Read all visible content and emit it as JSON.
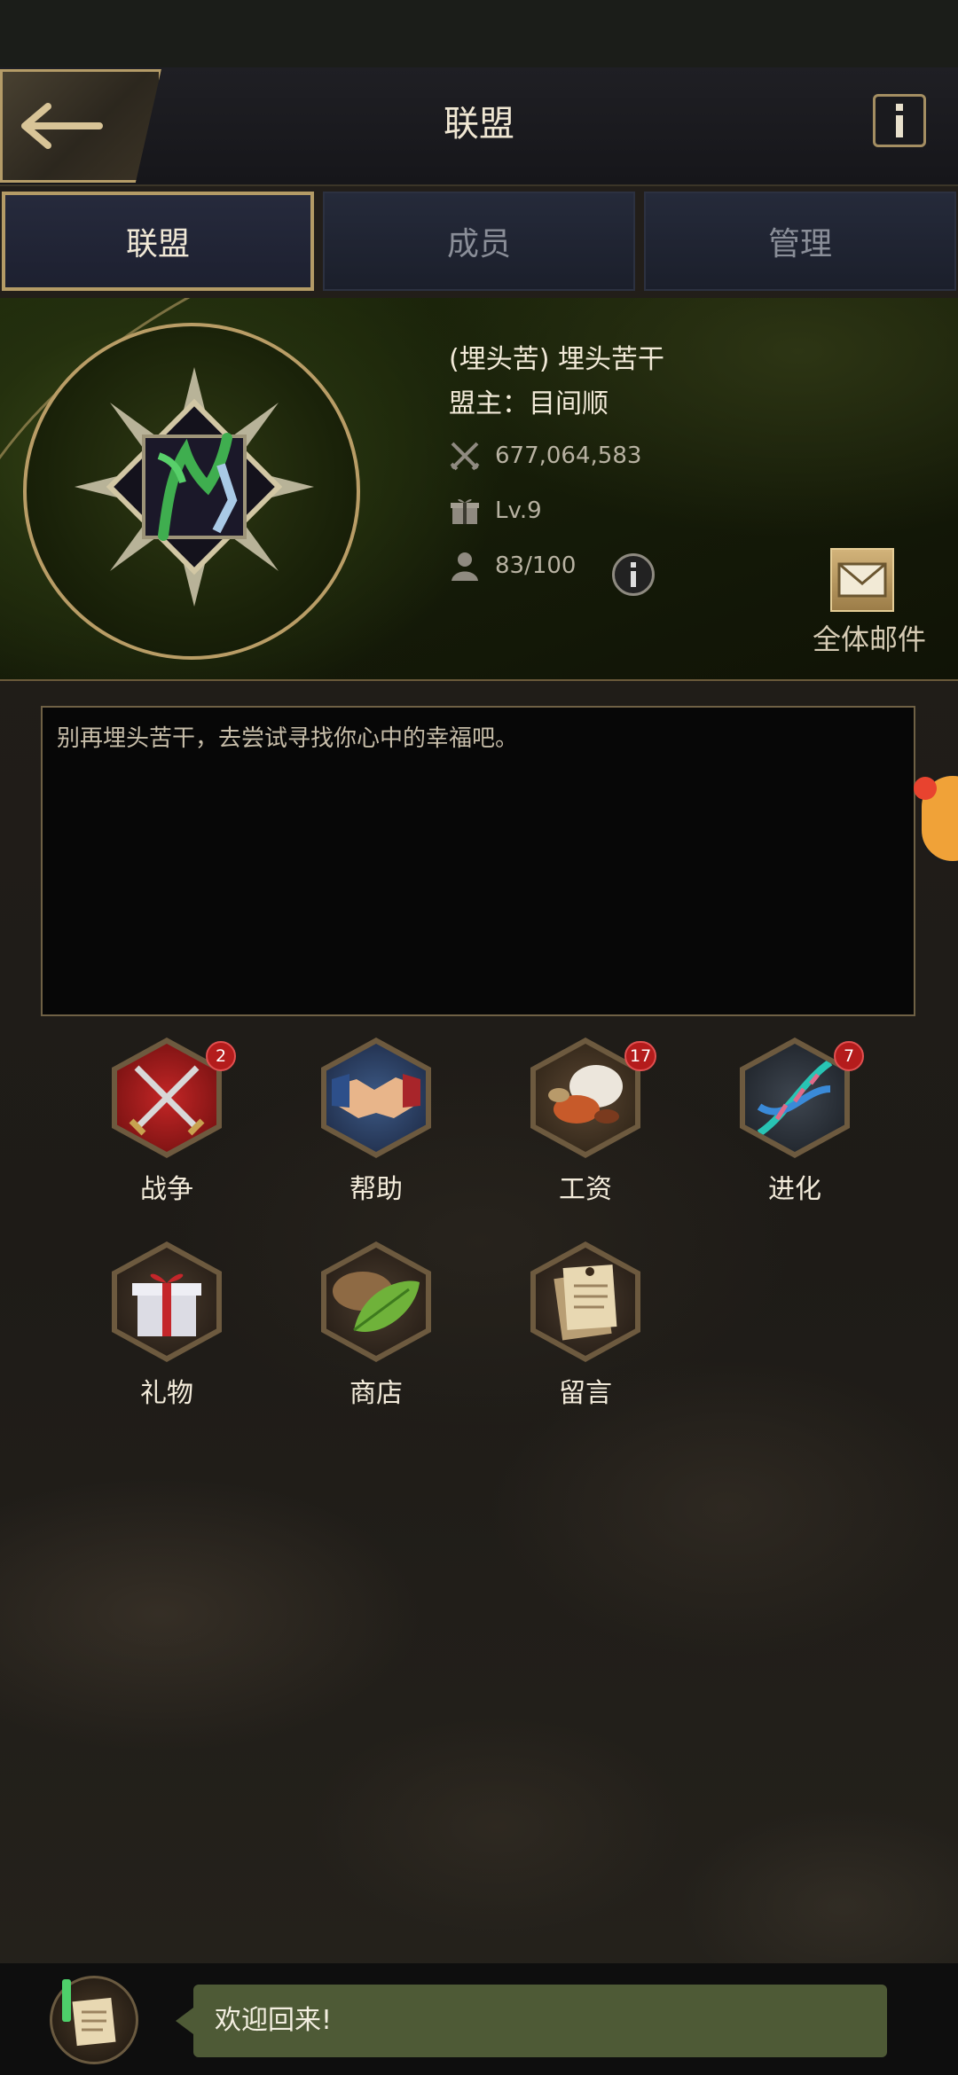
{
  "header": {
    "title": "联盟",
    "back_icon": "arrow-left-icon",
    "info_icon": "info-icon"
  },
  "tabs": [
    {
      "label": "联盟",
      "active": true
    },
    {
      "label": "成员",
      "active": false
    },
    {
      "label": "管理",
      "active": false
    }
  ],
  "alliance": {
    "name": "(埋头苦) 埋头苦干",
    "leader": "盟主：目间顺",
    "power": "677,064,583",
    "level": "Lv.9",
    "members": "83/100"
  },
  "mail": {
    "label": "全体邮件"
  },
  "notice": {
    "text": "别再埋头苦干，去尝试寻找你心中的幸福吧。"
  },
  "actions": [
    {
      "label": "战争",
      "badge": "2",
      "icon": "crossed-swords-icon"
    },
    {
      "label": "帮助",
      "badge": "",
      "icon": "handshake-icon"
    },
    {
      "label": "工资",
      "badge": "17",
      "icon": "food-icon"
    },
    {
      "label": "进化",
      "badge": "7",
      "icon": "dna-icon"
    },
    {
      "label": "礼物",
      "badge": "",
      "icon": "gift-icon"
    },
    {
      "label": "商店",
      "badge": "",
      "icon": "leaf-icon"
    },
    {
      "label": "留言",
      "badge": "",
      "icon": "notes-icon"
    }
  ],
  "chat": {
    "message": "欢迎回来!"
  },
  "colors": {
    "gold": "#b49b66",
    "badge_red": "#b41c1c",
    "chat_bubble": "#4e5a36"
  }
}
